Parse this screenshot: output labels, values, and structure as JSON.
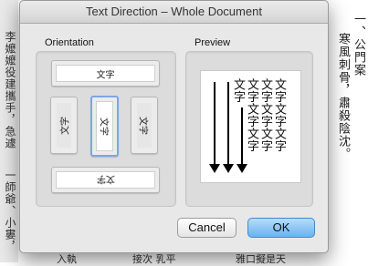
{
  "background": {
    "columns": [
      {
        "text": "一、公門案"
      },
      {
        "text": "寒風刺骨，肅殺陰沈。"
      }
    ],
    "left_columns": [
      {
        "text": "李嬤嬤役建攜手，急遽"
      },
      {
        "text": "一師爺、小婁，"
      }
    ],
    "bottom_fragments": [
      "入執",
      "接次 乳平",
      "雅口擬是天"
    ]
  },
  "dialog": {
    "title": "Text Direction – Whole Document",
    "orientation_label": "Orientation",
    "preview_label": "Preview",
    "options": [
      {
        "id": "horizontal-ltr",
        "sample": "文字"
      },
      {
        "id": "vertical-rotated-left",
        "sample": "文字"
      },
      {
        "id": "vertical-rl",
        "sample": "文字"
      },
      {
        "id": "vertical-rotated-right",
        "sample": "文字"
      },
      {
        "id": "horizontal-upside-down",
        "sample": "文字"
      }
    ],
    "selected_option": "vertical-rl",
    "preview": {
      "columns": [
        "文字",
        "文字文字文字",
        "文字文字文字",
        "文字文字文字"
      ]
    },
    "buttons": {
      "cancel": "Cancel",
      "ok": "OK"
    }
  }
}
